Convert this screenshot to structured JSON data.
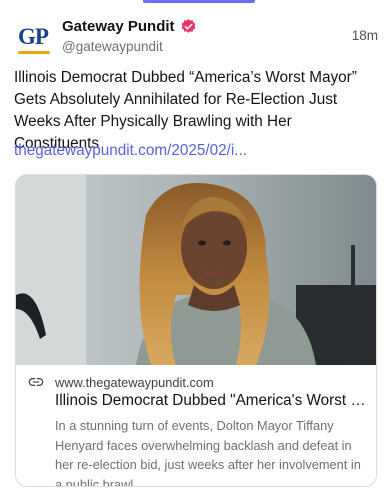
{
  "post": {
    "author_name": "Gateway Pundit",
    "handle": "@gatewaypundit",
    "time": "18m",
    "avatar_text": "GP",
    "text": "Illinois Democrat Dubbed “America’s Worst Mayor” Gets Absolutely Annihilated for Re-Election Just Weeks After Physically Brawling with Her Constituents",
    "link_text": "thegatewaypundit.com/2025/02/i..."
  },
  "card": {
    "domain": "www.thegatewaypundit.com",
    "title": "Illinois Democrat Dubbed \"America's Worst Mayor\" Gets Absolutely Annihilated",
    "description": "In a stunning turn of events, Dolton Mayor Tiffany Henyard faces overwhelming backlash and defeat in her re-election bid, just weeks after her involvement in a public brawl."
  },
  "icons": {
    "verified": "verified-badge-icon",
    "link": "link-chain-icon"
  },
  "colors": {
    "accent": "#6b6ef9",
    "link": "#5b5fe0",
    "verified": "#e8366b",
    "avatar_blue": "#1b3f8f",
    "avatar_gold": "#e8a600"
  }
}
